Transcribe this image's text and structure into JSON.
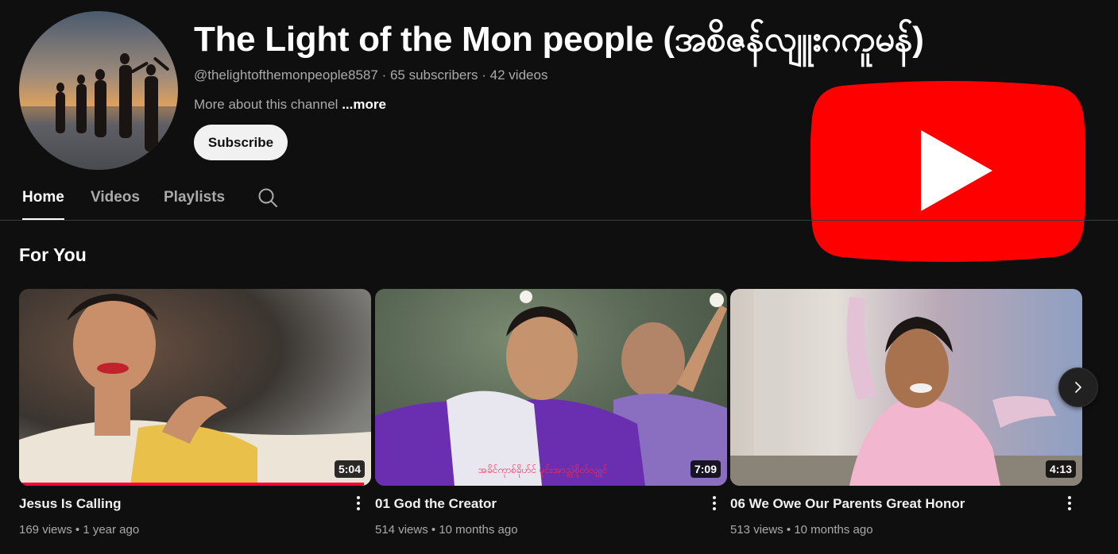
{
  "channel": {
    "title": "The Light of the Mon people (အစိဇန်လျူးဂကူမန်)",
    "handle": "@thelightofthemonpeople8587",
    "subscribers": "65 subscribers",
    "videos_count": "42 videos",
    "separator": "·",
    "about_text": "More about this channel",
    "about_more": "...more",
    "subscribe_label": "Subscribe"
  },
  "tabs": [
    {
      "label": "Home",
      "active": true
    },
    {
      "label": "Videos",
      "active": false
    },
    {
      "label": "Playlists",
      "active": false
    }
  ],
  "section": {
    "title": "For You"
  },
  "videos": [
    {
      "title": "Jesus Is Calling",
      "views": "169 views",
      "age": "1 year ago",
      "duration": "5:04",
      "watched_fraction": 0.98
    },
    {
      "title": "01 God the Creator",
      "views": "514 views",
      "age": "10 months ago",
      "duration": "7:09",
      "subtitle_text": "အခိင်ကုာစ်ခိုဟ်င် မုင်းအာသ္တဲစိုတ်လျူင်"
    },
    {
      "title": "06 We Owe Our Parents Great Honor",
      "views": "513 views",
      "age": "10 months ago",
      "duration": "4:13"
    }
  ],
  "meta_separator": "•",
  "colors": {
    "background": "#0f0f0f",
    "youtube_red": "#ff0000",
    "progress_red": "#ff0033",
    "text_secondary": "#aaaaaa"
  },
  "icons": {
    "search": "search-icon",
    "more": "more-vert-icon",
    "next": "chevron-right-icon",
    "logo": "youtube-logo-icon"
  }
}
